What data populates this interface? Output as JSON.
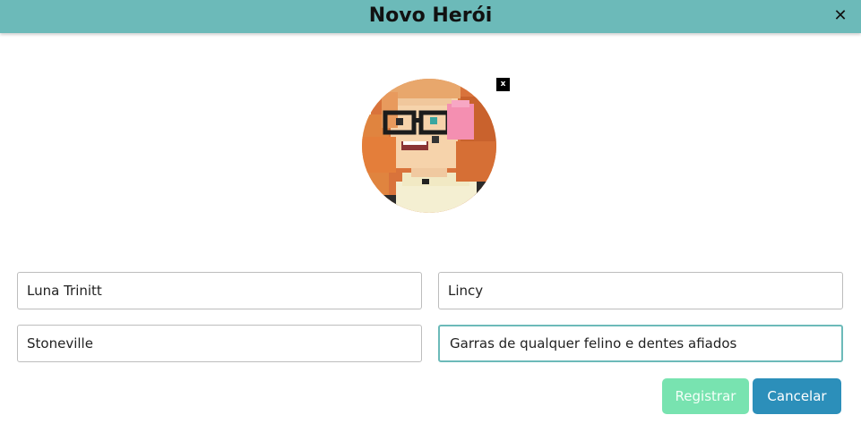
{
  "dialog": {
    "title": "Novo Herói",
    "close_label": "✕"
  },
  "avatar": {
    "remove_label": "x",
    "icon": "pixel-art-character-avatar"
  },
  "form": {
    "name_value": "Luna Trinitt",
    "nickname_value": "Lincy",
    "city_value": "Stoneville",
    "power_value": "Garras de qualquer felino e dentes afiados"
  },
  "actions": {
    "register_label": "Registrar",
    "cancel_label": "Cancelar"
  },
  "colors": {
    "header": "#6cbab9",
    "register_disabled": "#78e3b0",
    "cancel": "#2c8fba",
    "focus_border": "#6cbab9"
  }
}
